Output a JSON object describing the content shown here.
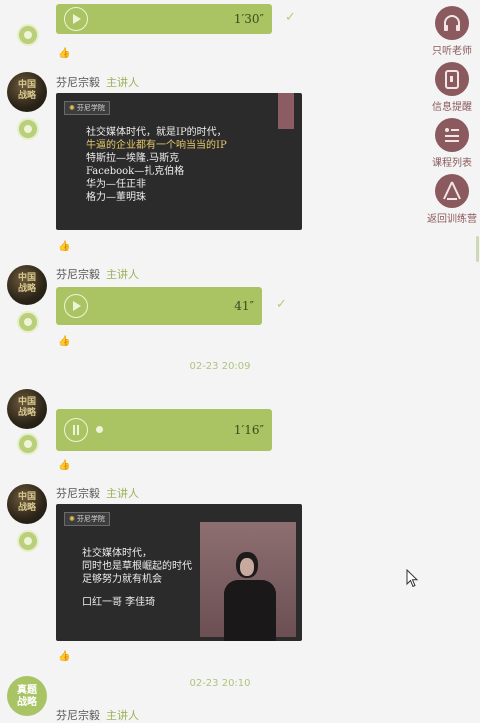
{
  "speaker": {
    "name": "芬尼宗毅",
    "role": "主讲人"
  },
  "messages": [
    {
      "type": "voice",
      "duration": "1′30″"
    },
    {
      "type": "image",
      "logo": "芬尼学院",
      "lines": [
        "社交媒体时代，就是IP的时代，",
        "牛逼的企业都有一个响当当的IP",
        "特斯拉—埃隆.马斯克",
        "Facebook—扎克伯格",
        "华为—任正非",
        "格力—董明珠"
      ]
    },
    {
      "type": "voice",
      "duration": "41″"
    },
    {
      "type": "timestamp",
      "text": "02-23 20:09"
    },
    {
      "type": "voice",
      "duration": "1′16″",
      "playing": true
    },
    {
      "type": "image",
      "logo": "芬尼学院",
      "lines": [
        "社交媒体时代，",
        "同时也是草根崛起的时代",
        "足够努力就有机会",
        "口红一哥  李佳琦"
      ]
    },
    {
      "type": "timestamp",
      "text": "02-23 20:10"
    }
  ],
  "avatar_text": "中国\n战略",
  "green_avatar_text": "真题\n战略",
  "sidebar": [
    {
      "label": "只听老师",
      "icon": "headphones-icon"
    },
    {
      "label": "信息提醒",
      "icon": "mobile-icon"
    },
    {
      "label": "课程列表",
      "icon": "list-icon"
    },
    {
      "label": "返回训练营",
      "icon": "camp-icon"
    }
  ],
  "colors": {
    "accent": "#aac464",
    "sidebar": "#8b5a5e",
    "card": "#2b2b2b"
  }
}
